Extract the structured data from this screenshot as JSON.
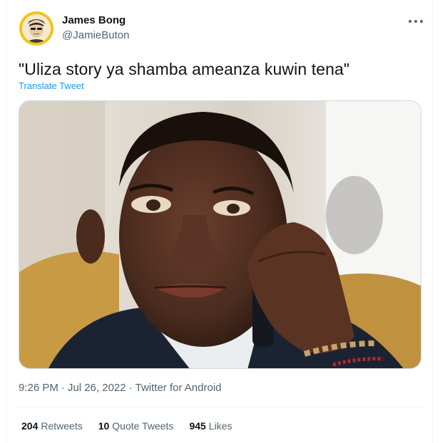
{
  "author": {
    "display_name": "James Bong",
    "handle": "@JamieButon"
  },
  "tweet": {
    "text": "\"Uliza story ya shamba ameanza kuwin tena\"",
    "translate_label": "Translate Tweet"
  },
  "meta": {
    "time": "9:26 PM",
    "separator": "·",
    "date": "Jul 26, 2022",
    "source": "Twitter for Android"
  },
  "stats": {
    "retweets": {
      "count": "204",
      "label": "Retweets"
    },
    "quotes": {
      "count": "10",
      "label": "Quote Tweets"
    },
    "likes": {
      "count": "945",
      "label": "Likes"
    }
  },
  "icons": {
    "more": "more-horizontal-icon"
  },
  "colors": {
    "accent": "#1d9bf0",
    "secondary_text": "#536471",
    "avatar_ring": "#f0c419"
  }
}
